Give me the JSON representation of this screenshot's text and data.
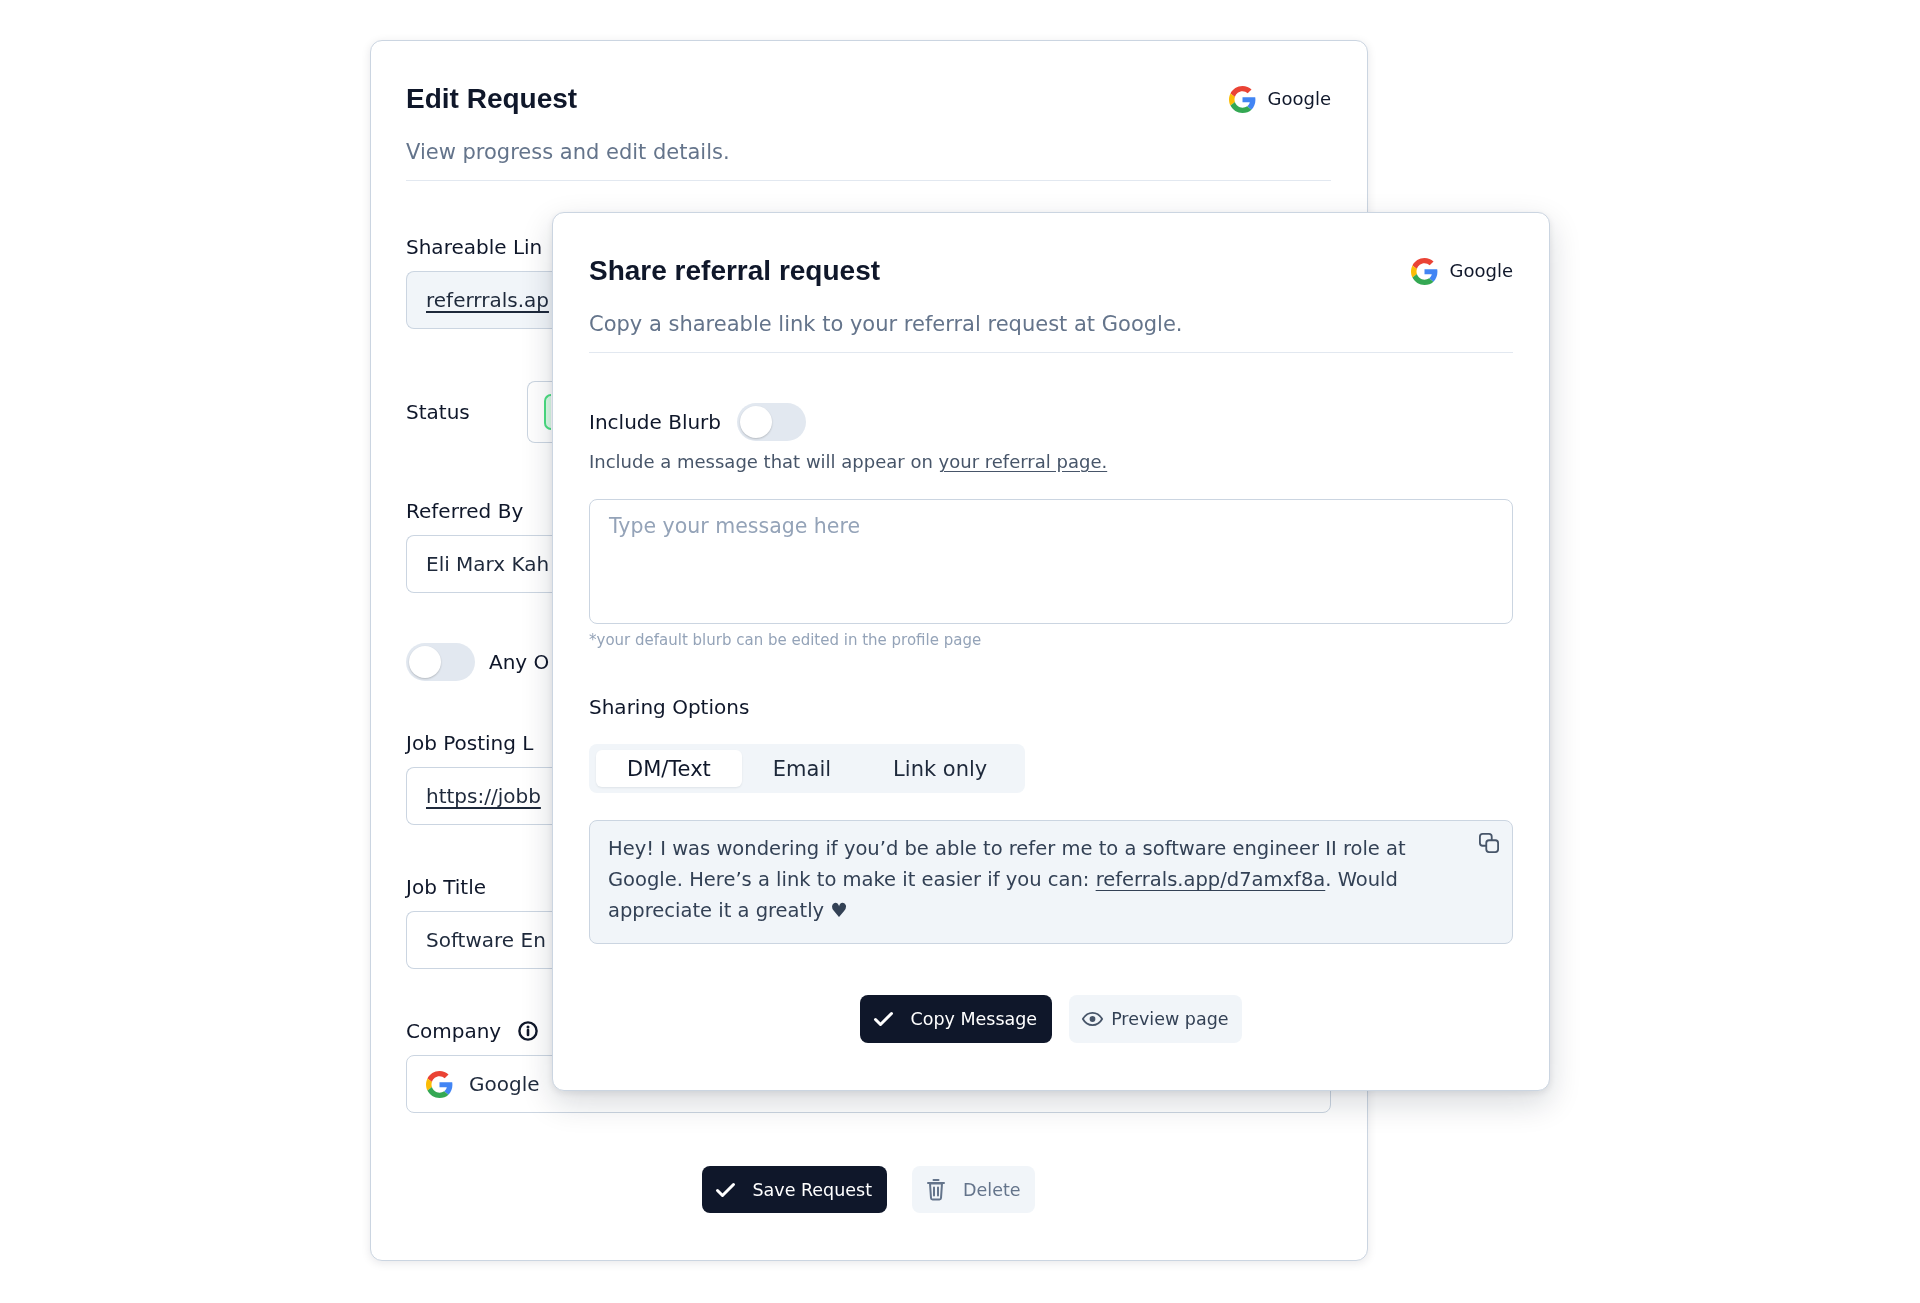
{
  "edit_request": {
    "title": "Edit Request",
    "company": "Google",
    "subtitle": "View progress and edit details.",
    "fields": [
      {
        "kind": "link",
        "label": "Shareable Lin",
        "value": "referrrals.ap",
        "readonly": true
      },
      {
        "kind": "status",
        "label": "Status"
      },
      {
        "kind": "text",
        "label": "Referred By",
        "value": "Eli Marx Kah"
      },
      {
        "kind": "toggle",
        "label": "Any O",
        "on": false
      },
      {
        "kind": "link",
        "label": "Job Posting L",
        "value": "https://jobb",
        "readonly": false
      },
      {
        "kind": "text",
        "label": "Job Title",
        "value": "Software En"
      },
      {
        "kind": "company",
        "label": "Company",
        "value": "Google"
      }
    ],
    "buttons": [
      {
        "kind": "confirm",
        "label": "Save Request"
      },
      {
        "kind": "delete",
        "label": "Delete"
      }
    ]
  },
  "share_dialog": {
    "title": "Share referral request",
    "company": "Google",
    "subtitle": "Copy a shareable link to your referral request at Google.",
    "include_blurb": {
      "label": "Include Blurb",
      "on": false
    },
    "blurb_hint": {
      "text": "Include a message that will appear on ",
      "link": "your referral page."
    },
    "message_input": {
      "placeholder": "Type your message here"
    },
    "footnote": "*your default blurb can be edited in the profile page",
    "sharing_options": {
      "label": "Sharing Options",
      "tabs": [
        {
          "label": "DM/Text",
          "selected": true
        },
        {
          "label": "Email",
          "selected": false
        },
        {
          "label": "Link only",
          "selected": false
        }
      ]
    },
    "message": {
      "text_before": "Hey! I was wondering if you’d be able to refer me to a software engineer II role at Google. Here’s a link to make it easier if you can: ",
      "link": "referrals.app/d7amxf8a",
      "text_after": ". Would appreciate it a greatly ♥"
    },
    "buttons": [
      {
        "kind": "confirm",
        "label": "Copy Message"
      },
      {
        "kind": "preview",
        "label": "Preview page"
      }
    ]
  }
}
